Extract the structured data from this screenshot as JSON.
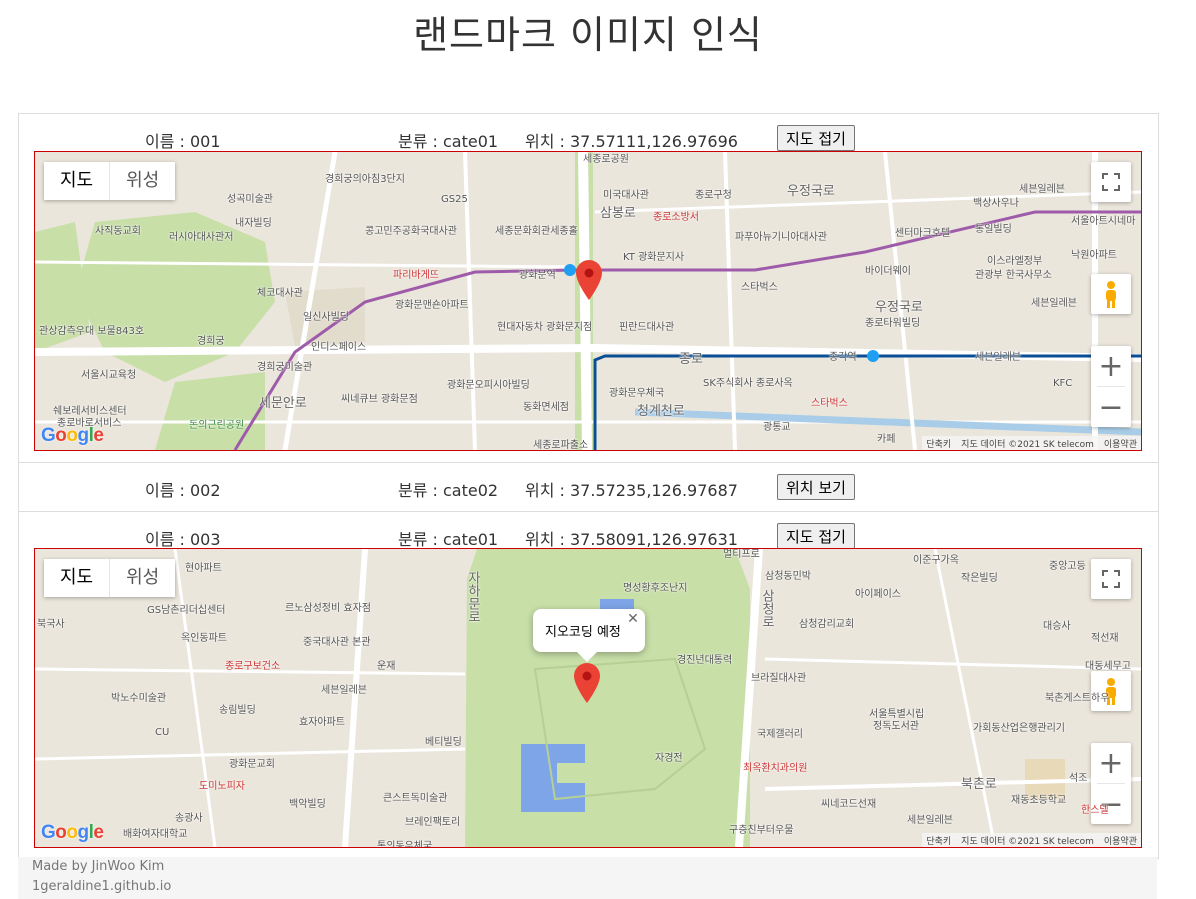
{
  "page": {
    "title": "랜드마크 이미지 인식"
  },
  "items": [
    {
      "name": "이름 : 001",
      "category": "분류 : cate01",
      "location": "위치 : 37.57111,126.97696",
      "toggle_label": "지도 접기",
      "map_type": {
        "map": "지도",
        "satellite": "위성"
      },
      "labels": [
        "세종로공원",
        "경희궁의아침3단지",
        "미국대사관",
        "종로구청",
        "우정국로",
        "세븐일레븐",
        "백상사우나",
        "서울아트시네마",
        "성곡미술관",
        "내자빌딩",
        "삼봉로",
        "종로소방서",
        "통일빌딩",
        "사직동교회",
        "러시아대사관저",
        "콩고민주공화국대사관",
        "세종문화회관세종홀",
        "파푸아뉴기니아대사관",
        "센터마크호텔",
        "이스라엘정부",
        "관광부 한국사무소",
        "낙원아파트",
        "GS25",
        "KT 광화문지사",
        "바이더웨이",
        "파리바게뜨",
        "광화문역",
        "체코대사관",
        "광화문맨숀아파트",
        "스타벅스",
        "우정국로",
        "종로타워빌딩",
        "세븐일레븐",
        "관상감측우대 보물843호",
        "경희궁",
        "일신사빌딩",
        "현대자동차 광화문지점",
        "핀란드대사관",
        "인디스페이스",
        "종로",
        "종각역",
        "세븐일레븐",
        "서울시교육청",
        "경희궁미술관",
        "광화문오피시아빌딩",
        "SK주식회사 종로사옥",
        "KFC",
        "쉐보레서비스센터",
        "종로바로서비스",
        "세문안로",
        "씨네큐브 광화문점",
        "동화면세점",
        "광화문우체국",
        "청계천로",
        "스타벅스",
        "돈의근린공원",
        "광통교",
        "세종로파출소",
        "카페"
      ],
      "attribution": {
        "keys": "단축키",
        "data": "지도 데이터 ©2021 SK telecom",
        "terms": "이용약관"
      },
      "google": "Google"
    },
    {
      "name": "이름 : 002",
      "category": "분류 : cate02",
      "location": "위치 : 37.57235,126.97687",
      "toggle_label": "위치 보기"
    },
    {
      "name": "이름 : 003",
      "category": "분류 : cate01",
      "location": "위치 : 37.58091,126.97631",
      "toggle_label": "지도 접기",
      "map_type": {
        "map": "지도",
        "satellite": "위성"
      },
      "labels": [
        "현아파트",
        "멀티프로",
        "이준구가옥",
        "중앙고등",
        "GS남촌리더십센터",
        "르노삼성정비 효자점",
        "명성황후조난지",
        "삼청동민박",
        "아이페이스",
        "작은빌딩",
        "북국사",
        "옥인동파트",
        "중국대사관 본관",
        "경진년대통력",
        "삼청감리교회",
        "대승사",
        "적선재",
        "종로구보건소",
        "운재",
        "브라질대사관",
        "대동세무고",
        "박노수미술관",
        "세븐일레븐",
        "북촌게스트하우",
        "송림빌딩",
        "효자아파트",
        "서울특별시립",
        "정독도서관",
        "가회동산업은행관리기",
        "CU",
        "국제갤러리",
        "베티빌딩",
        "광화문교회",
        "자경전",
        "최옥환치과의원",
        "도미노피자",
        "석조",
        "백악빌딩",
        "큰스트독미술관",
        "씨네코드선재",
        "세븐일레븐",
        "재동초등학교",
        "송광사",
        "한스델",
        "배화여자대학교",
        "브레인팩토리",
        "구층친부터우물",
        "통의동우체국",
        "자하문로",
        "북촌로",
        "삼청로"
      ],
      "infowindow": "지오코딩 예정",
      "attribution": {
        "keys": "단축키",
        "data": "지도 데이터 ©2021 SK telecom",
        "terms": "이용약관"
      },
      "google": "Google"
    }
  ],
  "footer": {
    "author": "Made by JinWoo Kim",
    "site": "1geraldine1.github.io"
  },
  "colors": {
    "map_bg": "#ebe6dc",
    "park": "#c8dfa8",
    "road": "#ffffff",
    "subway_purple": "#9d5ba9",
    "subway_blue": "#0a4e96",
    "pin": "#ea4335",
    "border": "#cc0000"
  }
}
